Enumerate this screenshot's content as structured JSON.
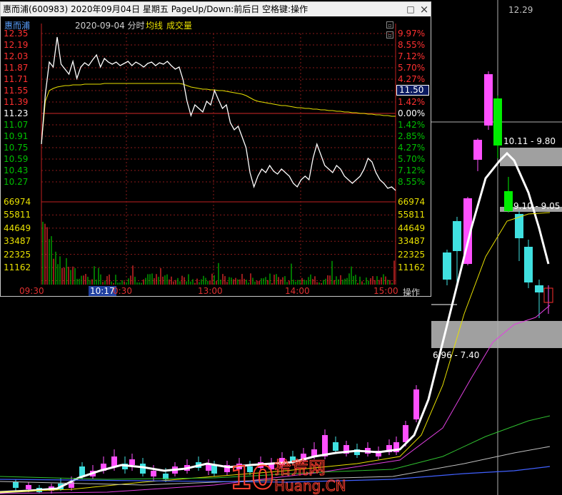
{
  "window": {
    "title": "惠而浦(600983) 2020年09月04日 星期五 PageUp/Down:前后日 空格键:操作",
    "minimize_glyph": "□",
    "close_glyph": "×"
  },
  "subheader": {
    "name": "惠而浦",
    "date_mode": "2020-09-04 分时",
    "avg_label": "均线",
    "volume_label": "成交量"
  },
  "colors": {
    "up": "#ff3030",
    "down": "#00c000",
    "flat": "#ffffff",
    "avg_line": "#e8e000",
    "price_line": "#ffffff",
    "grid": "#8b1a1a"
  },
  "price_axis": {
    "left": [
      "12.35",
      "12.19",
      "12.03",
      "11.87",
      "11.71",
      "11.55",
      "11.39",
      "11.23",
      "11.07",
      "10.91",
      "10.75",
      "10.59",
      "10.43",
      "10.27"
    ],
    "right": [
      "9.97%",
      "8.55%",
      "7.12%",
      "5.70%",
      "4.27%",
      "2.85%",
      "1.42%",
      "0.00%",
      "1.42%",
      "2.85%",
      "4.27%",
      "5.70%",
      "7.12%",
      "8.55%"
    ],
    "current_price": "11.50",
    "last_price_tag": "66974"
  },
  "volume_axis": {
    "left": [
      "66974",
      "55811",
      "44649",
      "33487",
      "22325",
      "11162"
    ],
    "right": [
      "66974",
      "55811",
      "44649",
      "33487",
      "22325",
      "11162"
    ]
  },
  "time_axis": {
    "labels": [
      "09:30",
      "13:00",
      "14:00",
      "15:00"
    ],
    "cursor_time": "10:17",
    "after_cursor": "0:30",
    "operate": "操作"
  },
  "intraday_data": {
    "type": "line",
    "open_close_reference": 11.23,
    "price": [
      10.8,
      11.5,
      11.95,
      11.88,
      12.3,
      11.92,
      11.85,
      11.78,
      11.96,
      11.72,
      11.88,
      11.94,
      11.9,
      11.98,
      12.05,
      11.88,
      12.0,
      11.95,
      11.92,
      11.95,
      11.9,
      11.93,
      11.96,
      11.9,
      11.95,
      11.92,
      11.88,
      11.93,
      11.95,
      11.9,
      11.94,
      11.92,
      11.96,
      11.9,
      11.85,
      11.88,
      11.7,
      11.4,
      11.2,
      11.35,
      11.3,
      11.25,
      11.4,
      11.35,
      11.55,
      11.42,
      11.3,
      11.35,
      11.1,
      11.0,
      11.05,
      10.9,
      10.75,
      10.4,
      10.2,
      10.35,
      10.45,
      10.4,
      10.5,
      10.42,
      10.38,
      10.45,
      10.4,
      10.35,
      10.25,
      10.2,
      10.3,
      10.35,
      10.3,
      10.6,
      10.8,
      10.65,
      10.5,
      10.45,
      10.4,
      10.5,
      10.45,
      10.35,
      10.3,
      10.25,
      10.3,
      10.35,
      10.45,
      10.6,
      10.55,
      10.4,
      10.3,
      10.25,
      10.18,
      10.2,
      10.15
    ],
    "avg": [
      10.8,
      11.4,
      11.55,
      11.58,
      11.6,
      11.61,
      11.62,
      11.62,
      11.63,
      11.63,
      11.63,
      11.64,
      11.64,
      11.64,
      11.64,
      11.64,
      11.65,
      11.65,
      11.65,
      11.65,
      11.65,
      11.65,
      11.65,
      11.65,
      11.65,
      11.65,
      11.65,
      11.65,
      11.65,
      11.65,
      11.65,
      11.65,
      11.65,
      11.65,
      11.65,
      11.65,
      11.64,
      11.62,
      11.6,
      11.59,
      11.58,
      11.57,
      11.57,
      11.56,
      11.56,
      11.55,
      11.55,
      11.54,
      11.53,
      11.52,
      11.51,
      11.5,
      11.48,
      11.45,
      11.42,
      11.4,
      11.39,
      11.38,
      11.37,
      11.36,
      11.35,
      11.34,
      11.34,
      11.33,
      11.32,
      11.31,
      11.31,
      11.3,
      11.3,
      11.29,
      11.29,
      11.28,
      11.28,
      11.27,
      11.27,
      11.26,
      11.26,
      11.25,
      11.25,
      11.24,
      11.24,
      11.23,
      11.23,
      11.22,
      11.22,
      11.21,
      11.21,
      11.2,
      11.2,
      11.19,
      11.19
    ]
  },
  "kline": {
    "price_tag": "12.29",
    "zone_upper": "10.11 - 9.80",
    "zone_mid": "9.10 - 9.05",
    "zone_lower": "6.96 - 7.40"
  },
  "watermark": {
    "brand_big": "10",
    "brand_cn": "拾荒网",
    "brand_en": "Huang.CN"
  }
}
